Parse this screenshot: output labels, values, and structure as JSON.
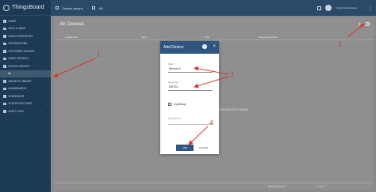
{
  "app": {
    "name": "ThingsBoard"
  },
  "sidebar": {
    "items": [
      {
        "label": "HOME",
        "expandable": false
      },
      {
        "label": "RULE CHAINS",
        "expandable": false
      },
      {
        "label": "DATA CONVERTERS",
        "expandable": false
      },
      {
        "label": "INTEGRATIONS",
        "expandable": false
      },
      {
        "label": "CUSTOMER GROUPS",
        "expandable": true
      },
      {
        "label": "ASSET GROUPS",
        "expandable": true
      },
      {
        "label": "DEVICE GROUPS",
        "expandable": true
      },
      {
        "label": "All",
        "sub": true,
        "active": true
      },
      {
        "label": "WIDGETS LIBRARY",
        "expandable": false
      },
      {
        "label": "DASHBOARDS",
        "expandable": false
      },
      {
        "label": "SCHEDULER",
        "expandable": false
      },
      {
        "label": "SYSTEM SETTINGS",
        "expandable": true
      },
      {
        "label": "AUDIT LOGS",
        "expandable": false
      }
    ]
  },
  "topbar": {
    "breadcrumb_group": "Device groups",
    "breadcrumb_sep": "›",
    "breadcrumb_current": "All",
    "user_text": "Tenant Administrator"
  },
  "main": {
    "title": "All: Devices",
    "columns": [
      "Created time",
      "Name",
      "Type",
      "Assigned customer"
    ],
    "empty_message": "NO DEVICES FOUND",
    "pager": {
      "items_per_page": "Items per page: 10",
      "range": "0 – 0 of 0"
    }
  },
  "dialog": {
    "title": "Add Device",
    "help_icon": "?",
    "close_icon": "×",
    "name_label": "Name *",
    "name_value": "Sensor A",
    "type_label": "Device type *",
    "type_value": "DHT22",
    "gateway_label": "Is gateway",
    "description_placeholder": "Description",
    "add_label": "ADD",
    "cancel_label": "CANCEL"
  },
  "annotations": {
    "color": "#d9342b",
    "labels": [
      "1",
      "2",
      "3",
      "4"
    ]
  }
}
